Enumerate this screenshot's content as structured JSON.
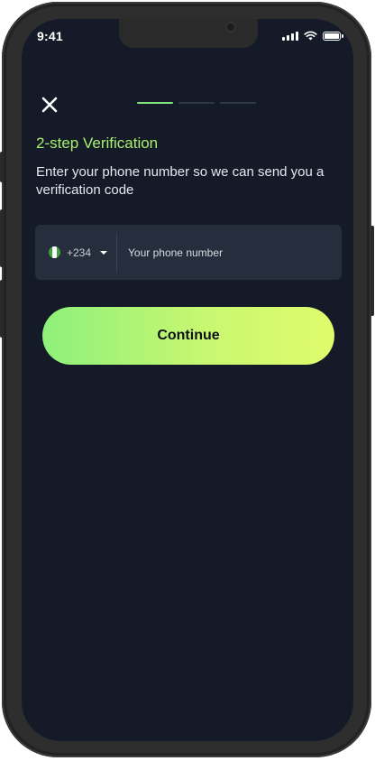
{
  "status_bar": {
    "time": "9:41",
    "icons": [
      "cellular-signal-icon",
      "wifi-icon",
      "battery-icon"
    ]
  },
  "header": {
    "close_icon": "close-icon",
    "progress": {
      "total_steps": 3,
      "current_step": 1
    }
  },
  "content": {
    "title": "2-step Verification",
    "subtitle": "Enter your phone number so we can send you a verification code"
  },
  "phone_input": {
    "flag_icon": "nigeria-flag-icon",
    "dial_code": "+234",
    "placeholder": "Your phone number",
    "value": ""
  },
  "continue_button": {
    "label": "Continue"
  },
  "colors": {
    "background": "#141a27",
    "accent": "#a8ef6e",
    "input_bg": "#262d3c",
    "progress_active": "#7fe27c",
    "progress_inactive": "#2f3646",
    "button_gradient": [
      "#8ef07a",
      "#e0fb6c"
    ]
  }
}
